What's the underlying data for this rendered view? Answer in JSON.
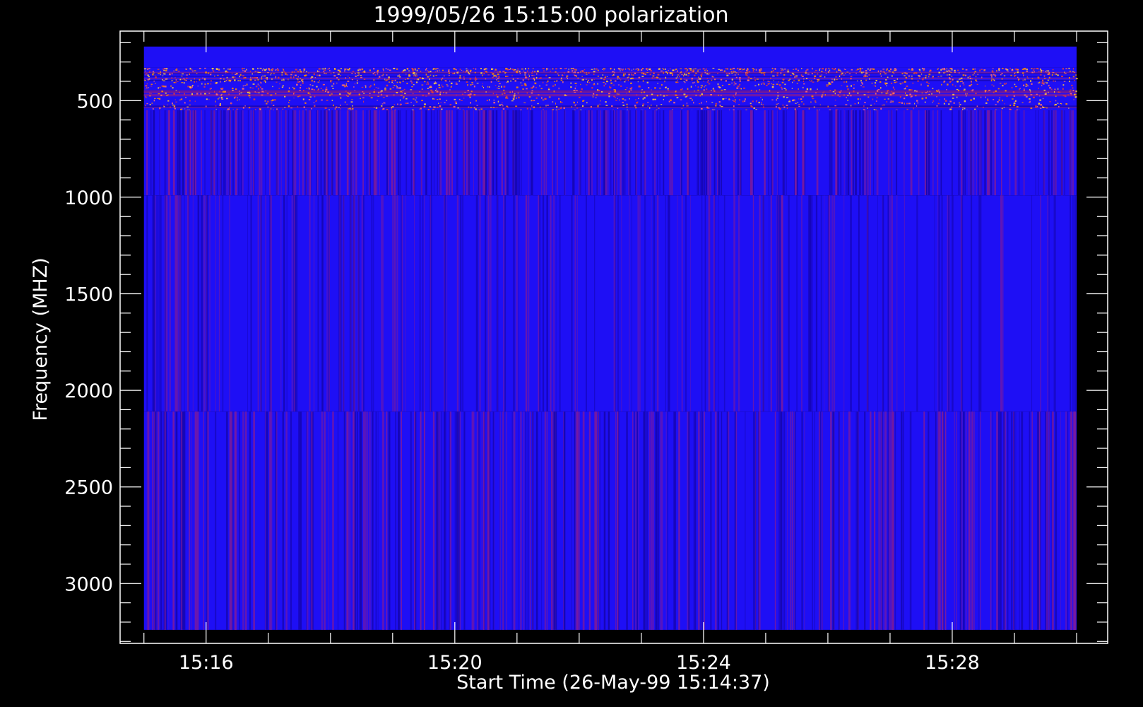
{
  "chart_data": {
    "type": "heatmap",
    "title": "1999/05/26 15:15:00 polarization",
    "xlabel": "Start Time (26-May-99 15:14:37)",
    "ylabel": "Frequency (MHZ)",
    "x_axis": {
      "unit": "time",
      "range": [
        "15:14:37",
        "15:30:30"
      ],
      "major_ticks": [
        "15:16",
        "15:20",
        "15:24",
        "15:28"
      ],
      "minor_tick_interval_min": 1
    },
    "y_axis": {
      "unit": "MHz",
      "inverted": true,
      "range": [
        3310,
        140
      ],
      "major_ticks": [
        500,
        1000,
        1500,
        2000,
        2500,
        3000
      ],
      "minor_tick_interval": 100
    },
    "data_extent": {
      "time_start": "15:15:00",
      "time_end": "15:30:00",
      "freq_min": 220,
      "freq_max": 3240
    },
    "bands": [
      {
        "freq_from": 220,
        "freq_to": 330,
        "pattern": "uniform"
      },
      {
        "freq_from": 330,
        "freq_to": 550,
        "pattern": "speckled"
      },
      {
        "freq_from": 550,
        "freq_to": 990,
        "pattern": "striated"
      },
      {
        "freq_from": 990,
        "freq_to": 2110,
        "pattern": "striated-light"
      },
      {
        "freq_from": 2110,
        "freq_to": 3240,
        "pattern": "striated"
      }
    ],
    "colors": {
      "background": "#000000",
      "axes": "#ffffff",
      "base": "#1e0ff5",
      "stripe_dark": "#1606b0",
      "stripe_red": "#7a1a9e",
      "speckle": [
        "#ff8c00",
        "#ffd23c",
        "#e03c3c",
        "#ff7070"
      ]
    },
    "grid": false,
    "legend": "none"
  }
}
